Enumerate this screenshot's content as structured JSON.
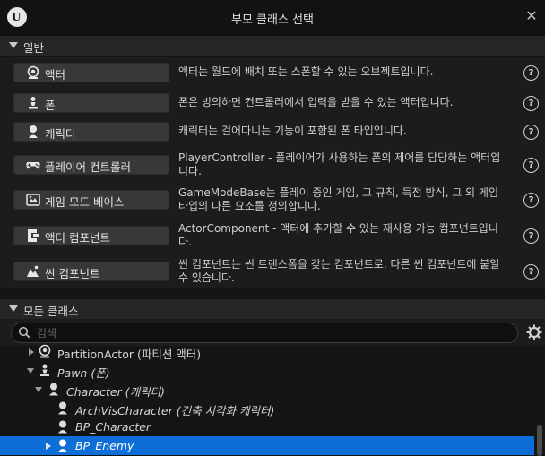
{
  "window": {
    "title": "부모 클래스 선택",
    "logo_text": "U"
  },
  "sections": {
    "common": "일반",
    "all_classes": "모든 클래스"
  },
  "common_classes": [
    {
      "label": "액터",
      "icon": "actor-icon",
      "desc": "액터는 월드에 배치 또는 스폰할 수 있는 오브젝트입니다."
    },
    {
      "label": "폰",
      "icon": "pawn-icon",
      "desc": "폰은 빙의하면 컨트롤러에서 입력을 받을 수 있는 액터입니다."
    },
    {
      "label": "캐릭터",
      "icon": "character-icon",
      "desc": "캐릭터는 걸어다니는 기능이 포함된 폰 타입입니다."
    },
    {
      "label": "플레이어 컨트롤러",
      "icon": "gamepad-icon",
      "desc": "PlayerController - 플레이어가 사용하는 폰의 제어를 담당하는 액터입니다."
    },
    {
      "label": "게임 모드 베이스",
      "icon": "game-mode-icon",
      "desc": "GameModeBase는 플레이 중인 게임, 그 규칙, 득점 방식, 그 외 게임 타입의 다른 요소를 정의합니다."
    },
    {
      "label": "액터 컴포넌트",
      "icon": "actor-component-icon",
      "desc": "ActorComponent - 액터에 추가할 수 있는 재사용 가능 컴포넌트입니다."
    },
    {
      "label": "씬 컴포넌트",
      "icon": "scene-component-icon",
      "desc": "씬 컴포넌트는 씬 트랜스폼을 갖는 컴포넌트로, 다른 씬 컴포넌트에 붙일 수 있습니다."
    }
  ],
  "help_glyph": "?",
  "search": {
    "placeholder": "검색",
    "value": ""
  },
  "tree": [
    {
      "label": "PartitionActor (파티션 액터)",
      "italic": false
    },
    {
      "label": "Pawn (폰)",
      "italic": true
    },
    {
      "label": "Character (캐릭터)",
      "italic": true
    },
    {
      "label": "ArchVisCharacter (건축 시각화 캐릭터)",
      "italic": true
    },
    {
      "label": "BP_Character",
      "italic": true
    },
    {
      "label": "BP_Enemy",
      "italic": true,
      "selected": true
    }
  ],
  "colors": {
    "selection": "#0d6ed8",
    "panel": "#1c1c1c",
    "button": "#383838"
  }
}
